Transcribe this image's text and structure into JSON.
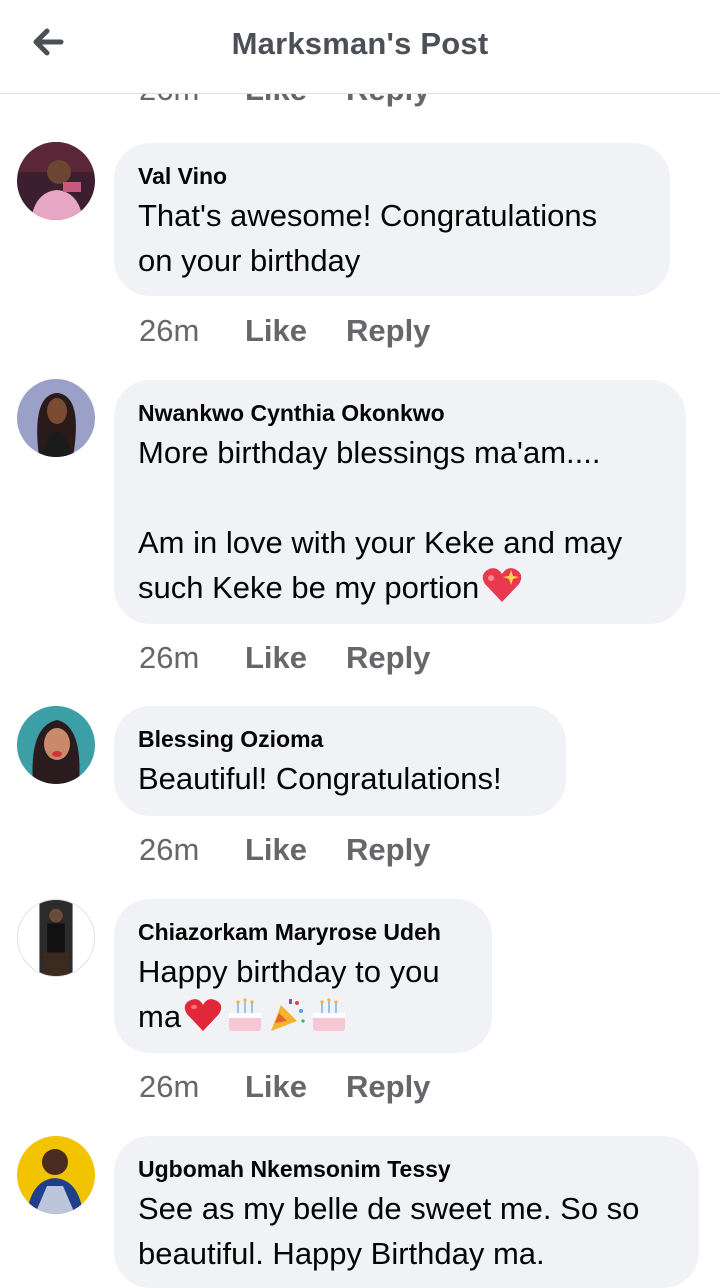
{
  "header": {
    "title": "Marksman's Post",
    "back_icon": "arrow-left-icon"
  },
  "partial_actions": {
    "time": "26m",
    "like": "Like",
    "reply": "Reply"
  },
  "comments": [
    {
      "author": "Val Vino",
      "text": "That's awesome! Congratulations\non your birthday",
      "time": "26m",
      "like": "Like",
      "reply": "Reply"
    },
    {
      "author": "Nwankwo Cynthia Okonkwo",
      "text": "More birthday blessings ma'am....\n\nAm in love with your Keke and may\nsuch Keke be my portion",
      "emoji": [
        "sparkling-heart-icon"
      ],
      "time": "26m",
      "like": "Like",
      "reply": "Reply"
    },
    {
      "author": "Blessing Ozioma",
      "text": "Beautiful! Congratulations!",
      "time": "26m",
      "like": "Like",
      "reply": "Reply"
    },
    {
      "author": "Chiazorkam Maryrose Udeh",
      "text": "Happy birthday to you\nma",
      "emoji": [
        "red-heart-icon",
        "birthday-cake-icon",
        "party-popper-icon",
        "birthday-cake-icon"
      ],
      "time": "26m",
      "like": "Like",
      "reply": "Reply"
    },
    {
      "author": "Ugbomah Nkemsonim Tessy",
      "text": "See as my belle de sweet me. So so\nbeautiful. Happy Birthday ma."
    }
  ],
  "colors": {
    "bubble": "#f0f2f5",
    "meta_text": "#65676b",
    "header_title": "#4b4f56",
    "divider": "#dddfe2"
  }
}
